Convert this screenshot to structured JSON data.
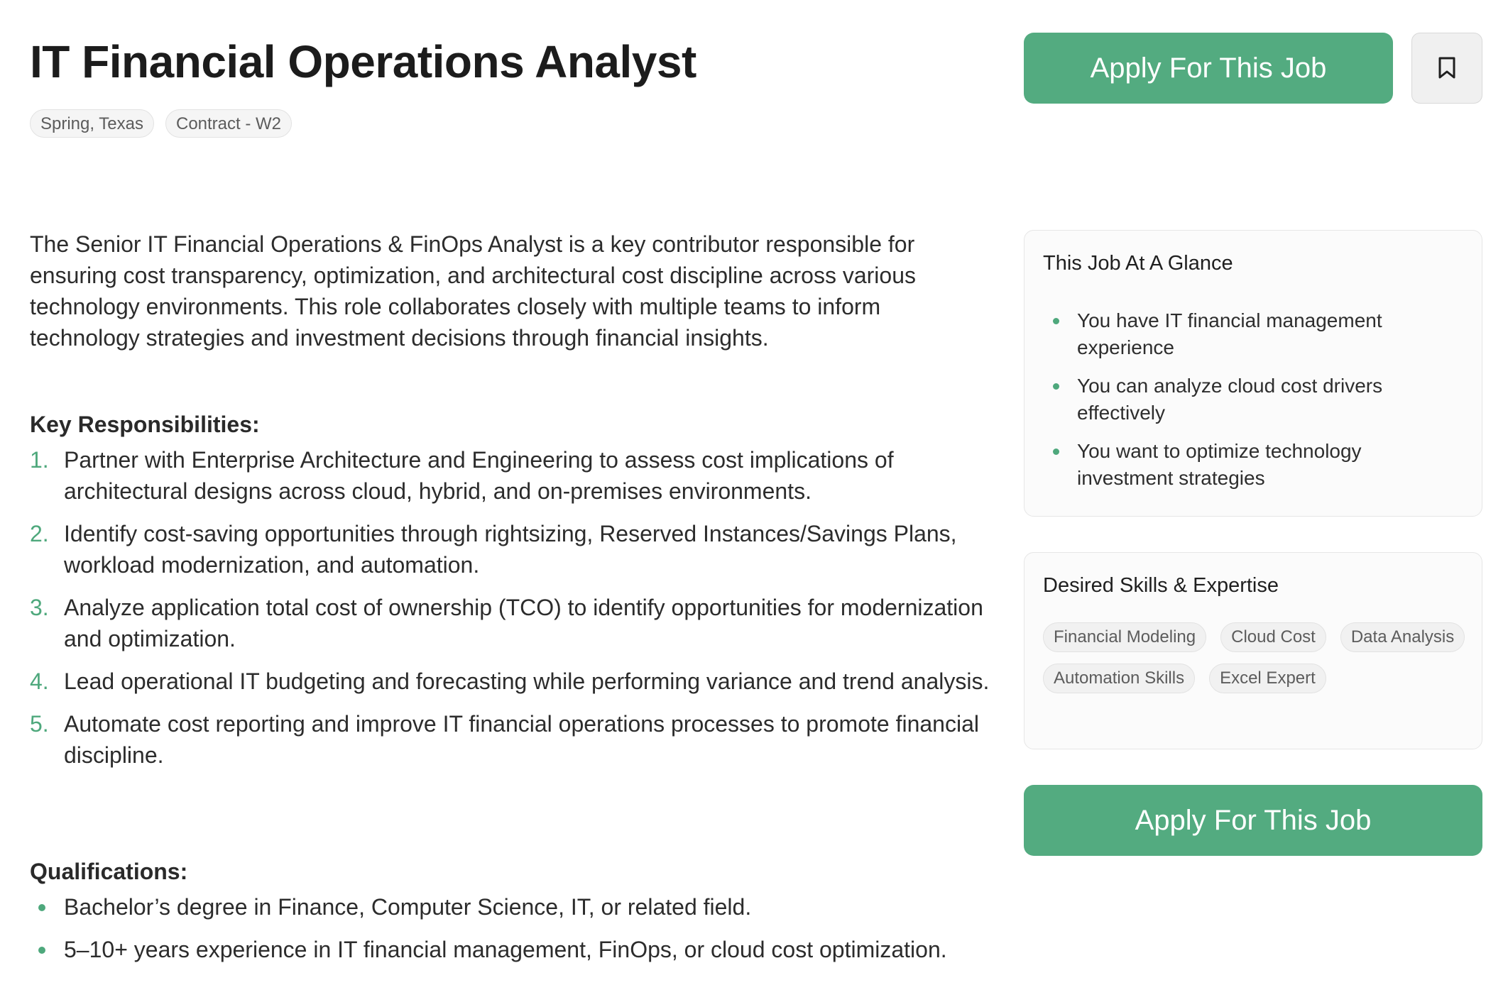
{
  "job": {
    "title": "IT Financial Operations Analyst",
    "tags": [
      "Spring, Texas",
      "Contract - W2"
    ],
    "description": "The Senior IT Financial Operations & FinOps Analyst is a key contributor responsible for ensuring cost transparency, optimization, and architectural cost discipline across various technology environments. This role collaborates closely with multiple teams to inform technology strategies and investment decisions through financial insights."
  },
  "responsibilities": {
    "heading": "Key Responsibilities:",
    "items": [
      {
        "marker": "1.",
        "text": "Partner with Enterprise Architecture and Engineering to assess cost implications of architectural designs across cloud, hybrid, and on-premises environments."
      },
      {
        "marker": "2.",
        "text": "Identify cost-saving opportunities through rightsizing, Reserved Instances/Savings Plans, workload modernization, and automation."
      },
      {
        "marker": "3.",
        "text": "Analyze application total cost of ownership (TCO) to identify opportunities for modernization and optimization."
      },
      {
        "marker": "4.",
        "text": "Lead operational IT budgeting and forecasting while performing variance and trend analysis."
      },
      {
        "marker": "5.",
        "text": "Automate cost reporting and improve IT financial operations processes to promote financial discipline."
      }
    ]
  },
  "qualifications": {
    "heading": "Qualifications:",
    "items": [
      "Bachelor’s degree in Finance, Computer Science, IT, or related field.",
      "5–10+ years experience in IT financial management, FinOps, or cloud cost optimization."
    ]
  },
  "actions": {
    "apply_label": "Apply For This Job",
    "bookmark_icon": "bookmark-icon"
  },
  "glance": {
    "title": "This Job At A Glance",
    "items": [
      "You have IT financial management experience",
      "You can analyze cloud cost drivers effectively",
      "You want to optimize technology investment strategies"
    ]
  },
  "skills": {
    "title": "Desired Skills & Expertise",
    "items": [
      "Financial Modeling",
      "Cloud Cost",
      "Data Analysis",
      "Automation Skills",
      "Excel Expert"
    ]
  },
  "colors": {
    "accent": "#53ab80",
    "marker": "#4ea87c",
    "tag_bg": "#f5f5f5",
    "text": "#2c2c2c"
  }
}
